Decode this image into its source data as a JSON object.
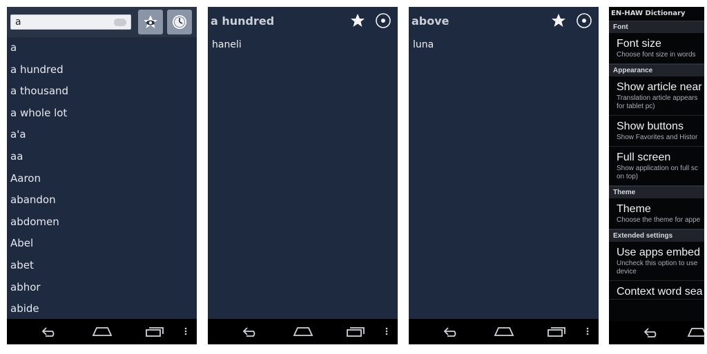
{
  "panel1": {
    "search": {
      "value": "a"
    },
    "icons": [
      "favorites-icon",
      "history-icon"
    ],
    "words": [
      "a",
      "a hundred",
      "a thousand",
      "a whole lot",
      "a'a",
      "aa",
      "Aaron",
      "abandon",
      "abdomen",
      "Abel",
      "abet",
      "abhor",
      "abide"
    ]
  },
  "panel2": {
    "title": "a hundred",
    "translation": "haneli"
  },
  "panel3": {
    "title": "above",
    "translation": "luna"
  },
  "panel4": {
    "app_title": "EN-HAW Dictionary",
    "sections": [
      {
        "category": "Font",
        "items": [
          {
            "title": "Font size",
            "summary": [
              "Choose font size in words"
            ]
          }
        ]
      },
      {
        "category": "Appearance",
        "items": [
          {
            "title": "Show article near",
            "summary": [
              "Translation article appears",
              "for tablet pc)"
            ]
          },
          {
            "title": "Show buttons",
            "summary": [
              "Show Favorites and Histor"
            ]
          },
          {
            "title": "Full screen",
            "summary": [
              "Show application on full sc",
              "on top)"
            ]
          }
        ]
      },
      {
        "category": "Theme",
        "items": [
          {
            "title": "Theme",
            "summary": [
              "Choose the theme for appe"
            ]
          }
        ]
      },
      {
        "category": "Extended settings",
        "items": [
          {
            "title": "Use apps embed",
            "summary": [
              "Uncheck this option to use",
              "device"
            ]
          },
          {
            "title": "Context word sea",
            "summary": []
          }
        ]
      }
    ]
  },
  "colors": {
    "panel_bg": "#1e2a40",
    "navbar": "#000000",
    "settings_bg": "#050607"
  }
}
